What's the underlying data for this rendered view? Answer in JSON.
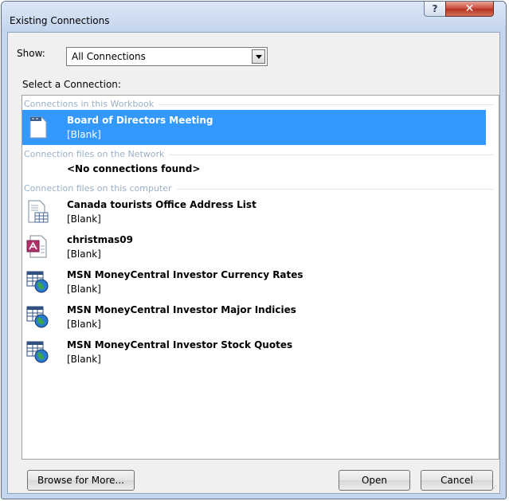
{
  "window": {
    "title": "Existing Connections"
  },
  "titlebar": {
    "help_glyph": "?",
    "close_glyph": "✕"
  },
  "show": {
    "label": "Show:",
    "value": "All Connections"
  },
  "select_label": "Select a Connection:",
  "groups": [
    {
      "header": "Connections in this Workbook"
    },
    {
      "header": "Connection files on the Network"
    },
    {
      "header": "Connection files on this computer"
    }
  ],
  "items": [
    {
      "name": "Board of Directors Meeting",
      "desc": "[Blank]",
      "icon": "document-icon",
      "selected": true
    },
    {
      "name": "Canada tourists Office Address List",
      "desc": "[Blank]",
      "icon": "table-document-icon"
    },
    {
      "name": "christmas09",
      "desc": "[Blank]",
      "icon": "access-database-icon"
    },
    {
      "name": "MSN MoneyCentral Investor Currency Rates",
      "desc": "[Blank]",
      "icon": "web-query-icon"
    },
    {
      "name": "MSN MoneyCentral Investor Major Indicies",
      "desc": "[Blank]",
      "icon": "web-query-icon"
    },
    {
      "name": "MSN MoneyCentral Investor Stock Quotes",
      "desc": "[Blank]",
      "icon": "web-query-icon"
    }
  ],
  "network_empty": "<No connections found>",
  "buttons": {
    "browse": "Browse for More...",
    "open": "Open",
    "cancel": "Cancel"
  },
  "colors": {
    "selection": "#3399ff",
    "group_header": "#9ab0c8",
    "frame": "#c5d6ec"
  }
}
